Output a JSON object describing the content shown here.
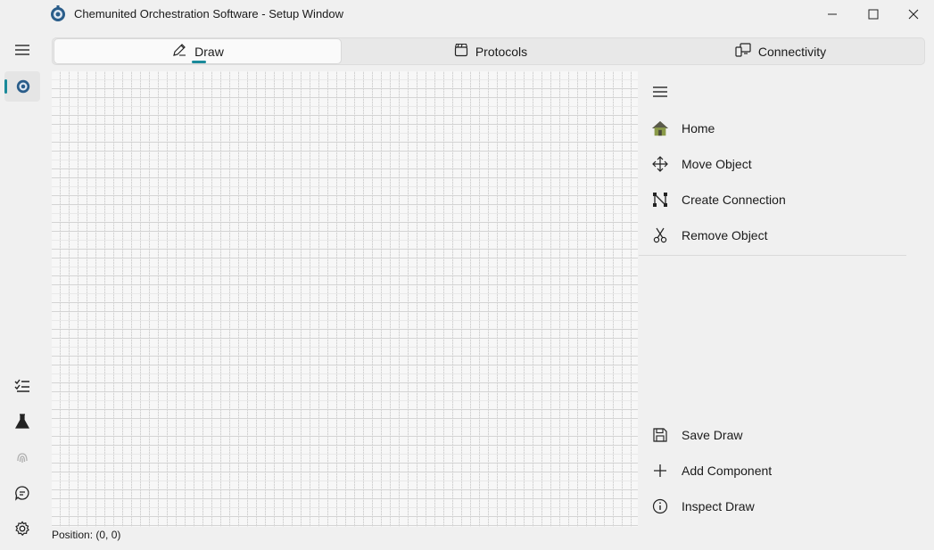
{
  "window": {
    "title": "Chemunited Orchestration Software - Setup Window"
  },
  "tabs": [
    {
      "label": "Draw",
      "icon": "pen-icon",
      "active": true
    },
    {
      "label": "Protocols",
      "icon": "clapperboard-icon",
      "active": false
    },
    {
      "label": "Connectivity",
      "icon": "devices-icon",
      "active": false
    }
  ],
  "toolbox": {
    "top_items": [
      {
        "label": "Home",
        "icon": "home-icon"
      },
      {
        "label": "Move Object",
        "icon": "move-icon"
      },
      {
        "label": "Create Connection",
        "icon": "connection-icon"
      },
      {
        "label": "Remove Object",
        "icon": "scissors-icon"
      }
    ],
    "bottom_items": [
      {
        "label": "Save Draw",
        "icon": "save-icon"
      },
      {
        "label": "Add Component",
        "icon": "plus-icon"
      },
      {
        "label": "Inspect Draw",
        "icon": "info-icon"
      }
    ]
  },
  "status": {
    "position": "Position: (0, 0)"
  },
  "colors": {
    "accent": "#1a8a9a",
    "background": "#f0f0f0"
  }
}
